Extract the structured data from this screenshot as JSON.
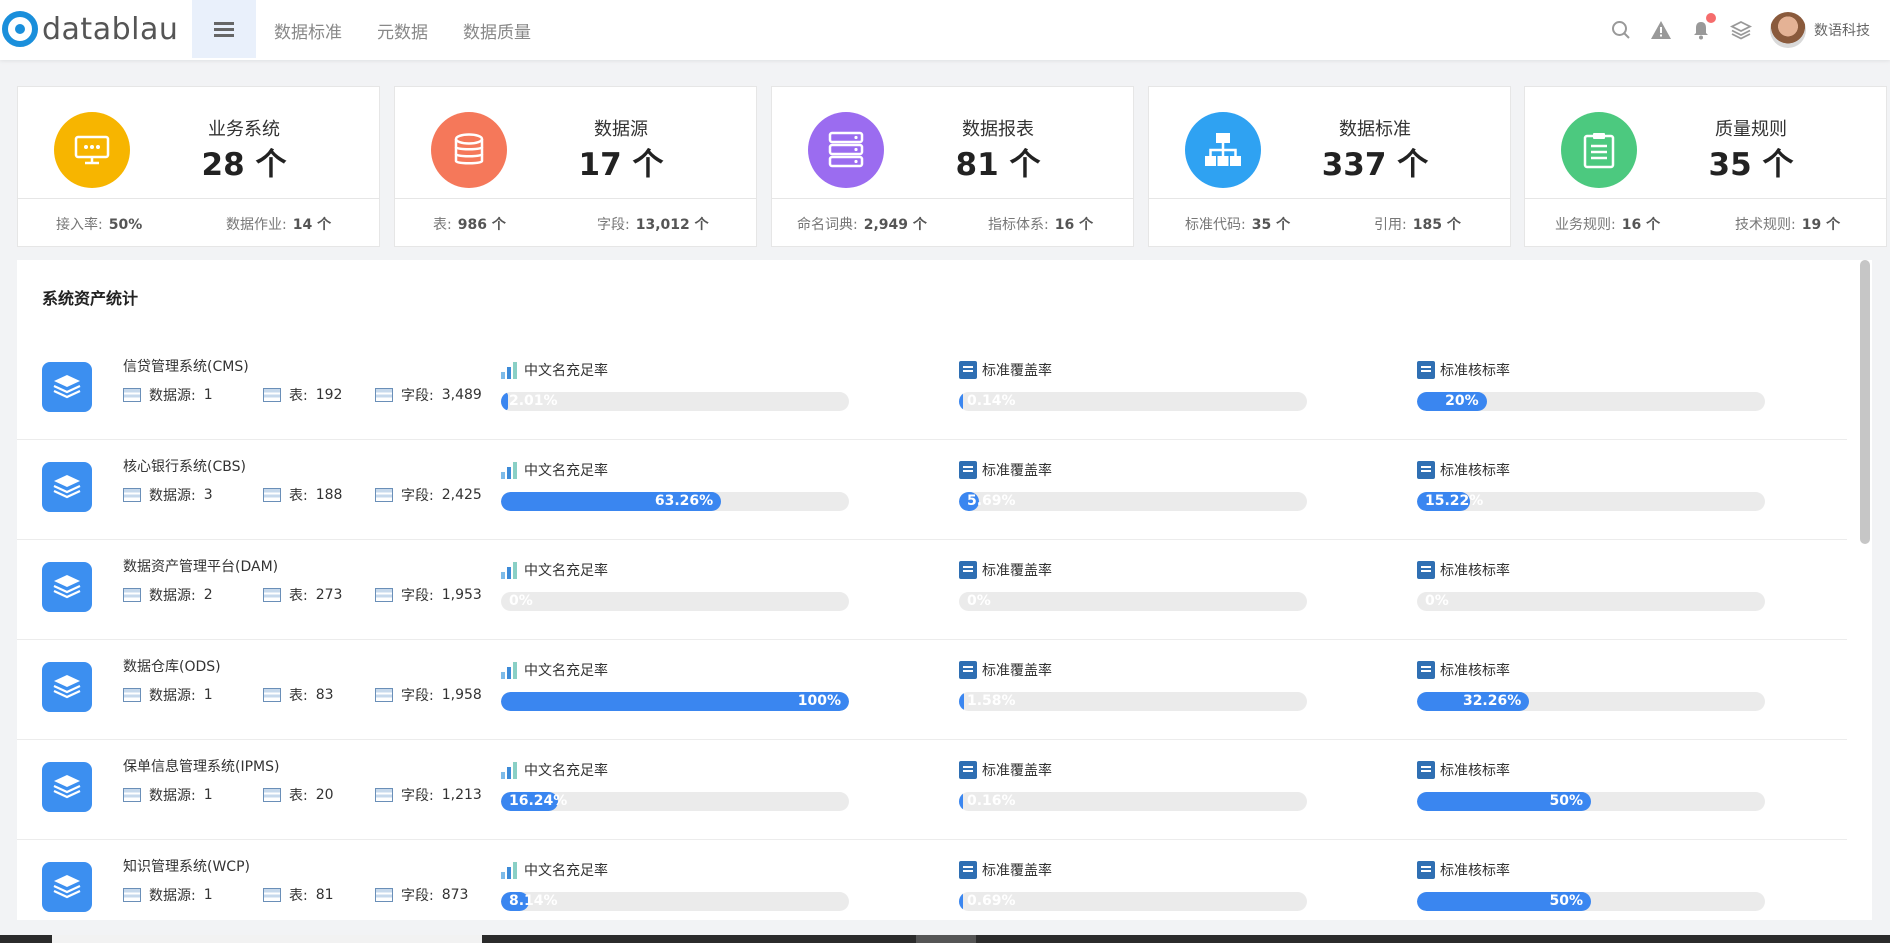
{
  "header": {
    "logo_text": "datablau",
    "nav": [
      "数据标准",
      "元数据",
      "数据质量"
    ],
    "user_name": "数语科技",
    "icons": [
      "search-icon",
      "warning-icon",
      "bell-icon",
      "layers-icon"
    ]
  },
  "cards": [
    {
      "title": "业务系统",
      "value": "28 个",
      "color": "#f7b500",
      "icon": "monitor-icon",
      "foot": [
        {
          "label": "接入率:",
          "value": "50%"
        },
        {
          "label": "数据作业:",
          "value": "14 个"
        }
      ]
    },
    {
      "title": "数据源",
      "value": "17 个",
      "color": "#f5785a",
      "icon": "database-icon",
      "foot": [
        {
          "label": "表:",
          "value": "986 个"
        },
        {
          "label": "字段:",
          "value": "13,012 个"
        }
      ]
    },
    {
      "title": "数据报表",
      "value": "81 个",
      "color": "#9b6cf0",
      "icon": "server-icon",
      "foot": [
        {
          "label": "命名词典:",
          "value": "2,949 个"
        },
        {
          "label": "指标体系:",
          "value": "16 个"
        }
      ]
    },
    {
      "title": "数据标准",
      "value": "337 个",
      "color": "#2fa2f2",
      "icon": "hierarchy-icon",
      "foot": [
        {
          "label": "标准代码:",
          "value": "35 个"
        },
        {
          "label": "引用:",
          "value": "185 个"
        }
      ]
    },
    {
      "title": "质量规则",
      "value": "35 个",
      "color": "#4cc97f",
      "icon": "clipboard-icon",
      "foot": [
        {
          "label": "业务规则:",
          "value": "16 个"
        },
        {
          "label": "技术规则:",
          "value": "19 个"
        }
      ]
    }
  ],
  "stats": {
    "title": "系统资产统计",
    "labels": {
      "datasource": "数据源:",
      "table": "表:",
      "field": "字段:"
    },
    "metric_names": [
      "中文名充足率",
      "标准覆盖率",
      "标准核标率"
    ],
    "systems": [
      {
        "name": "信贷管理系统(CMS)",
        "datasource": "1",
        "table": "192",
        "field": "3,489",
        "metrics": [
          {
            "text": "2.01%",
            "value": 2.01
          },
          {
            "text": "0.14%",
            "value": 0.14
          },
          {
            "text": "20%",
            "value": 20
          }
        ]
      },
      {
        "name": "核心银行系统(CBS)",
        "datasource": "3",
        "table": "188",
        "field": "2,425",
        "metrics": [
          {
            "text": "63.26%",
            "value": 63.26
          },
          {
            "text": "5.69%",
            "value": 5.69
          },
          {
            "text": "15.22%",
            "value": 15.22
          }
        ]
      },
      {
        "name": "数据资产管理平台(DAM)",
        "datasource": "2",
        "table": "273",
        "field": "1,953",
        "metrics": [
          {
            "text": "0%",
            "value": 0
          },
          {
            "text": "0%",
            "value": 0
          },
          {
            "text": "0%",
            "value": 0
          }
        ]
      },
      {
        "name": "数据仓库(ODS)",
        "datasource": "1",
        "table": "83",
        "field": "1,958",
        "metrics": [
          {
            "text": "100%",
            "value": 100
          },
          {
            "text": "1.58%",
            "value": 1.58
          },
          {
            "text": "32.26%",
            "value": 32.26
          }
        ]
      },
      {
        "name": "保单信息管理系统(IPMS)",
        "datasource": "1",
        "table": "20",
        "field": "1,213",
        "metrics": [
          {
            "text": "16.24%",
            "value": 16.24
          },
          {
            "text": "0.16%",
            "value": 0.16
          },
          {
            "text": "50%",
            "value": 50
          }
        ]
      },
      {
        "name": "知识管理系统(WCP)",
        "datasource": "1",
        "table": "81",
        "field": "873",
        "metrics": [
          {
            "text": "8.14%",
            "value": 8.14
          },
          {
            "text": "0.69%",
            "value": 0.69
          },
          {
            "text": "50%",
            "value": 50
          }
        ]
      }
    ]
  }
}
